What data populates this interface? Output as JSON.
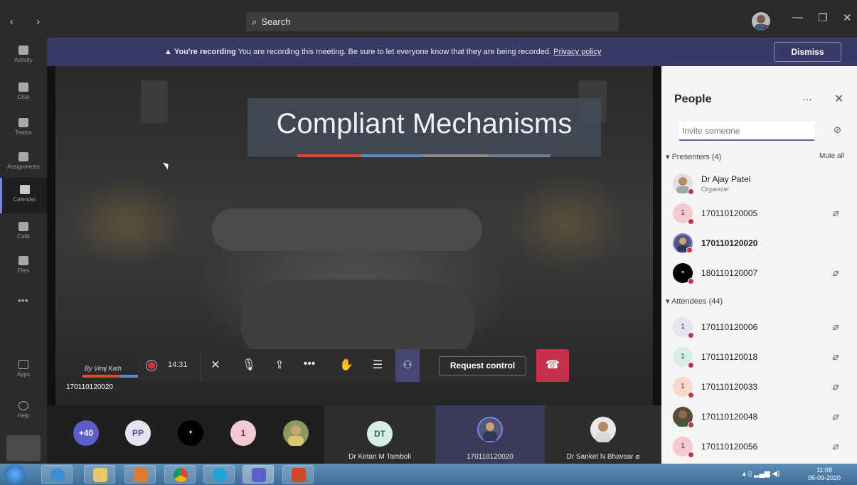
{
  "titlebar": {
    "nav": "‹ ›",
    "search_placeholder": "Search"
  },
  "rail": {
    "items": [
      {
        "label": "Activity",
        "icon": "bell-icon"
      },
      {
        "label": "Chat",
        "icon": "chat-icon"
      },
      {
        "label": "Teams",
        "icon": "teams-icon"
      },
      {
        "label": "Assignments",
        "icon": "assignments-icon"
      },
      {
        "label": "Calendar",
        "icon": "calendar-icon"
      },
      {
        "label": "Calls",
        "icon": "phone-icon"
      },
      {
        "label": "Files",
        "icon": "files-icon"
      }
    ],
    "more": "•••",
    "apps": "Apps",
    "help": "Help"
  },
  "banner": {
    "bold": "You're recording",
    "text": "You are recording this meeting. Be sure to let everyone know that they are being recorded.",
    "link": "Privacy policy",
    "dismiss": "Dismiss"
  },
  "stage": {
    "slide_title": "Compliant Mechanisms",
    "presenter_tag": "By Viraj Kath",
    "name": "170110120020"
  },
  "controls": {
    "timer": "14:31",
    "request_control": "Request control"
  },
  "strip": {
    "overflow": "+40",
    "pp": "PP",
    "one": "1",
    "dt": "DT",
    "tiles": [
      {
        "name": "Dr Ketan M Tamboli"
      },
      {
        "name": "170110120020"
      },
      {
        "name": "Dr Sanket N Bhavsar"
      }
    ]
  },
  "people": {
    "title": "People",
    "more": "···",
    "close": "✕",
    "invite_placeholder": "Invite someone",
    "presenters_header": "Presenters (4)",
    "mute_all": "Mute all",
    "attendees_header": "Attendees (44)",
    "presenters": [
      {
        "name": "Dr Ajay Patel",
        "sub": "Organizer",
        "initial": "",
        "bold": false,
        "muted": false
      },
      {
        "name": "170110120005",
        "sub": "",
        "initial": "1",
        "bold": false,
        "muted": true
      },
      {
        "name": "170110120020",
        "sub": "",
        "initial": "",
        "bold": true,
        "muted": false
      },
      {
        "name": "180110120007",
        "sub": "",
        "initial": "",
        "bold": false,
        "muted": true
      }
    ],
    "attendees": [
      {
        "name": "170110120006",
        "initial": "1",
        "muted": true
      },
      {
        "name": "170110120018",
        "initial": "1",
        "muted": true
      },
      {
        "name": "170110120033",
        "initial": "1",
        "muted": true
      },
      {
        "name": "170110120048",
        "initial": "",
        "muted": true
      },
      {
        "name": "170110120056",
        "initial": "1",
        "muted": true
      }
    ]
  },
  "taskbar": {
    "time": "11:08",
    "date": "05-09-2020"
  }
}
